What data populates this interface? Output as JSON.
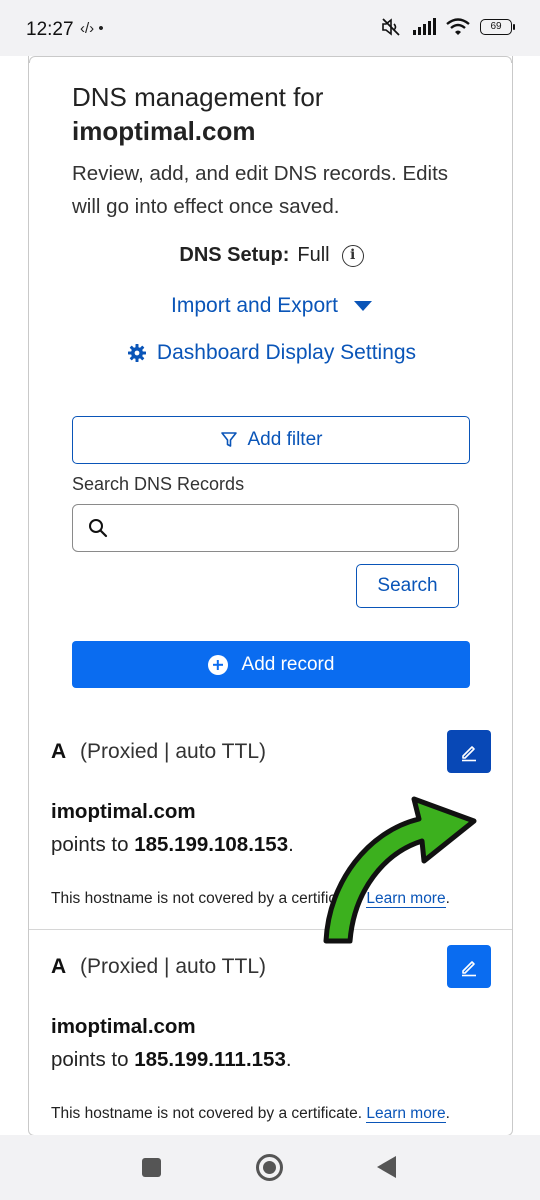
{
  "status_bar": {
    "time": "12:27",
    "extra": "‹/› •",
    "battery": "69"
  },
  "header": {
    "title_prefix": "DNS management for",
    "domain": "imoptimal.com",
    "description": "Review, add, and edit DNS records. Edits will go into effect once saved."
  },
  "dns_setup": {
    "label": "DNS Setup:",
    "value": "Full"
  },
  "links": {
    "import_export": "Import and Export",
    "dashboard_settings": "Dashboard Display Settings"
  },
  "filter": {
    "add_filter_label": "Add filter",
    "search_label": "Search DNS Records",
    "search_placeholder": "",
    "search_button": "Search",
    "add_record_label": "Add record"
  },
  "records": [
    {
      "type": "A",
      "meta": "(Proxied | auto TTL)",
      "host": "imoptimal.com",
      "points_prefix": "points to",
      "ip": "185.199.108.153",
      "suffix": ".",
      "note": "This hostname is not covered by a certificate.",
      "learn_more": "Learn more"
    },
    {
      "type": "A",
      "meta": "(Proxied | auto TTL)",
      "host": "imoptimal.com",
      "points_prefix": "points to",
      "ip": "185.199.111.153",
      "suffix": ".",
      "note": "This hostname is not covered by a certificate.",
      "learn_more": "Learn more"
    }
  ],
  "colors": {
    "link_blue": "#0a55b8",
    "primary_blue": "#0a6cf0",
    "edit_active": "#0848b6",
    "arrow_green": "#3cb01e"
  }
}
